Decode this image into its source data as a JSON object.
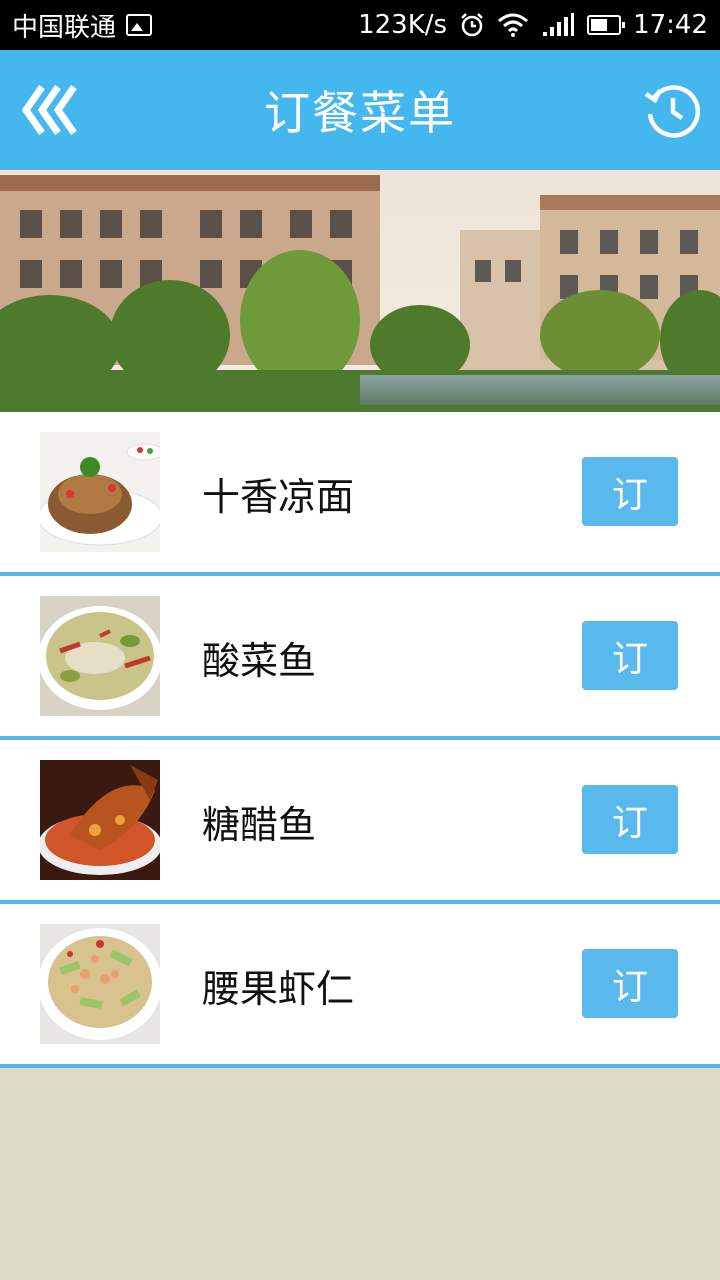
{
  "status_bar": {
    "carrier": "中国联通",
    "net_speed": "123K/s",
    "time": "17:42",
    "icons": [
      "image-icon",
      "alarm-icon",
      "wifi-icon",
      "signal-icon",
      "battery-icon"
    ]
  },
  "header": {
    "title": "订餐菜单",
    "back_icon": "double-chevron-left-icon",
    "refresh_icon": "refresh-history-icon",
    "color": "#44b8ee"
  },
  "banner": {
    "description_icon": "banner-image"
  },
  "menu": {
    "items": [
      {
        "name": "十香凉面",
        "order_label": "订"
      },
      {
        "name": "酸菜鱼",
        "order_label": "订"
      },
      {
        "name": "糖醋鱼",
        "order_label": "订"
      },
      {
        "name": "腰果虾仁",
        "order_label": "订"
      }
    ],
    "accent": "#55b7e9",
    "button_color": "#5ab9ec"
  }
}
